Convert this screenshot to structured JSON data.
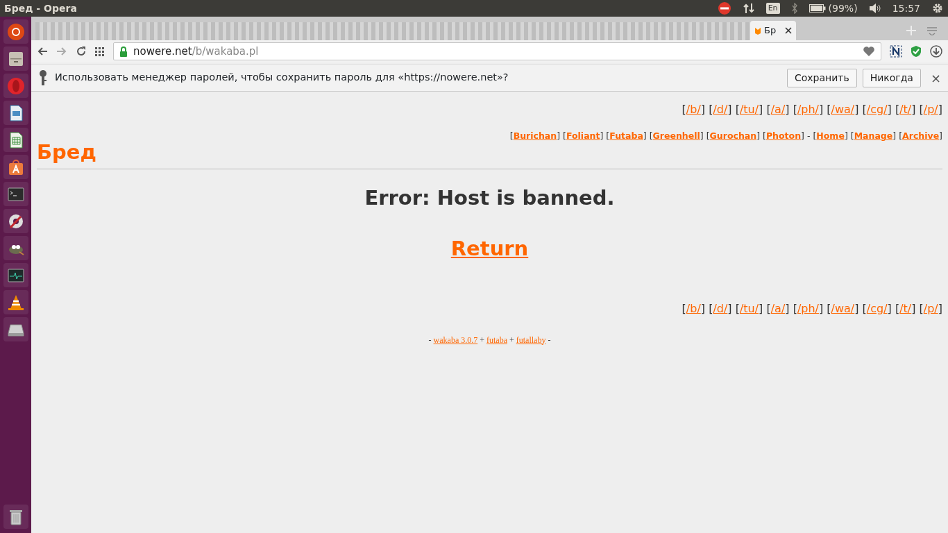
{
  "top_panel": {
    "title": "Бред - Opera",
    "keyboard_layout": "En",
    "battery": "(99%)",
    "clock": "15:57"
  },
  "tabs": [
    {
      "label": "Бр",
      "selected": true
    }
  ],
  "address": {
    "host": "nowere.net",
    "path": "/b/wakaba.pl"
  },
  "password_bar": {
    "message": "Использовать менеджер паролей, чтобы сохранить пароль для «https://nowere.net»?",
    "buttons": [
      "Сохранить",
      "Никогда"
    ],
    "close": "×"
  },
  "page": {
    "brackets": [
      "[",
      "]"
    ],
    "board_nav_top": [
      "/b/",
      "/d/",
      "/tu/",
      "/a/",
      "/ph/",
      "/wa/",
      "/cg/",
      "/t/",
      "/p/"
    ],
    "style_nav": [
      "Burichan",
      "Foliant",
      "Futaba",
      "Greenhell",
      "Gurochan",
      "Photon"
    ],
    "nav_divider": "-",
    "site_nav": [
      "Home",
      "Manage",
      "Archive"
    ],
    "title": "Бред",
    "error": "Error: Host is banned.",
    "return_link": "Return",
    "board_nav_bottom": [
      "/b/",
      "/d/",
      "/tu/",
      "/a/",
      "/ph/",
      "/wa/",
      "/cg/",
      "/t/",
      "/p/"
    ],
    "footer": {
      "edge": "-",
      "links": [
        "wakaba 3.0.7",
        "futaba",
        "futallaby"
      ],
      "joiner": "+"
    }
  }
}
